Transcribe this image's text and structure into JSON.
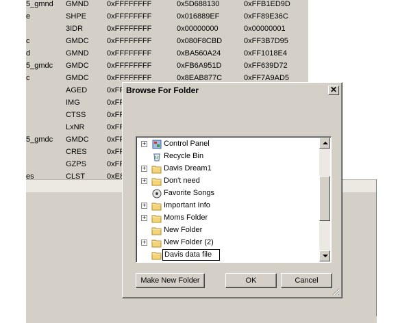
{
  "background_table": {
    "rows": [
      [
        "5_gmnd",
        "GMND",
        "0xFFFFFFFF",
        "0x5D688130",
        "0xFFB1ED9D"
      ],
      [
        "e",
        "SHPE",
        "0xFFFFFFFF",
        "0x016889EF",
        "0xFF89E36C"
      ],
      [
        "",
        "3IDR",
        "0xFFFFFFFF",
        "0x00000000",
        "0x00000001"
      ],
      [
        "c",
        "GMDC",
        "0xFFFFFFFF",
        "0x080F8CBD",
        "0xFF3B7D95"
      ],
      [
        "d",
        "GMND",
        "0xFFFFFFFF",
        "0xBA560A24",
        "0xFF1018E4"
      ],
      [
        "5_gmdc",
        "GMDC",
        "0xFFFFFFFF",
        "0xFB6A951D",
        "0xFF639D72"
      ],
      [
        "c",
        "GMDC",
        "0xFFFFFFFF",
        "0x8EAB877C",
        "0xFF7A9AD5"
      ],
      [
        "",
        "AGED",
        "0xFF",
        "",
        ""
      ],
      [
        "",
        "IMG",
        "0xFF",
        "",
        ""
      ],
      [
        "",
        "CTSS",
        "0xFF",
        "",
        ""
      ],
      [
        "",
        "LxNR",
        "0xFF",
        "",
        ""
      ],
      [
        "5_gmdc",
        "GMDC",
        "0xFF",
        "",
        ""
      ],
      [
        "",
        "CRES",
        "0xFF",
        "",
        ""
      ],
      [
        "",
        "GZPS",
        "0xFF",
        "",
        ""
      ],
      [
        "es",
        "CLST",
        "0xE8",
        "",
        ""
      ]
    ]
  },
  "dialog": {
    "title": "Browse For Folder",
    "close_glyph": "✕",
    "tree": [
      {
        "label": "Control Panel",
        "icon": "control-panel-icon",
        "expandable": true
      },
      {
        "label": "Recycle Bin",
        "icon": "recycle-bin-icon",
        "expandable": false
      },
      {
        "label": "Davis Dream1",
        "icon": "folder-icon",
        "expandable": true
      },
      {
        "label": "Don't need",
        "icon": "folder-icon",
        "expandable": true
      },
      {
        "label": "Favorite Songs",
        "icon": "music-folder-icon",
        "expandable": false
      },
      {
        "label": "Important Info",
        "icon": "folder-icon",
        "expandable": true
      },
      {
        "label": "Moms Folder",
        "icon": "folder-icon",
        "expandable": true
      },
      {
        "label": "New Folder",
        "icon": "folder-icon",
        "expandable": false
      },
      {
        "label": "New Folder (2)",
        "icon": "folder-icon",
        "expandable": true
      },
      {
        "label": "Davis data file",
        "icon": "folder-icon",
        "expandable": false,
        "editing": true
      }
    ],
    "buttons": {
      "make_new_folder": "Make New Folder",
      "ok": "OK",
      "cancel": "Cancel"
    }
  }
}
